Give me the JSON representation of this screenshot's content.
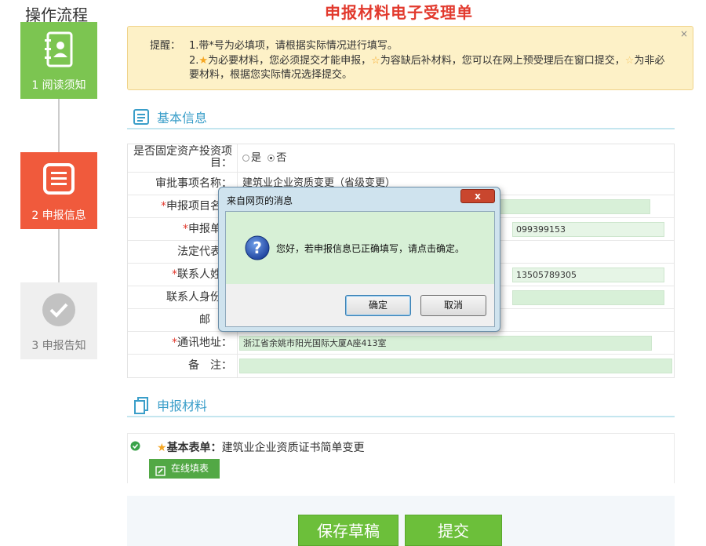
{
  "sidebar": {
    "title": "操作流程",
    "steps": [
      {
        "label": "1 阅读须知"
      },
      {
        "label": "2 申报信息"
      },
      {
        "label": "3 申报告知"
      }
    ]
  },
  "page": {
    "title": "申报材料电子受理单"
  },
  "notice": {
    "label": "提醒：",
    "line1": "1.带*号为必填项，请根据实际情况进行填写。",
    "line2a": "2.",
    "line2b": "为必要材料，您必须提交才能申报，",
    "line2c": "为容缺后补材料，您可以在网上预受理后在窗口提交，",
    "line2d": "为非必要材料，根据您实际情况选择提交。",
    "close": "×"
  },
  "basic": {
    "heading": "基本信息",
    "rows": [
      {
        "label": "是否固定资产投资项目：",
        "yes": "是",
        "no": "否"
      },
      {
        "label": "审批事项名称：",
        "value": "建筑业企业资质变更（省级变更）"
      },
      {
        "label": "申报项目名称",
        "value": ""
      },
      {
        "label": "申报单位",
        "value": "",
        "right_value": "099399153"
      },
      {
        "label": "法定代表人",
        "value": ""
      },
      {
        "label": "联系人姓名",
        "value": "",
        "right_value": "13505789305"
      },
      {
        "label": "联系人身份证",
        "value": ""
      },
      {
        "label": "邮　编",
        "value": ""
      },
      {
        "label": "通讯地址：",
        "value": "浙江省余姚市阳光国际大厦A座413室"
      },
      {
        "label": "备　注：",
        "value": ""
      }
    ],
    "required_mark": "*"
  },
  "materials": {
    "heading": "申报材料",
    "item_label": "基本表单：",
    "item_value": "建筑业企业资质证书简单变更",
    "online_button": "在线填表"
  },
  "actions": {
    "save": "保存草稿",
    "submit": "提交"
  },
  "dialog": {
    "title": "来自网页的消息",
    "close": "x",
    "message": "您好，若申报信息已正确填写，请点击确定。",
    "ok": "确定",
    "cancel": "取消"
  },
  "colors": {
    "accent_green": "#6cbf3a",
    "accent_red": "#f05a3c",
    "title_red": "#e23a2e",
    "heading_blue": "#3a9ec9"
  }
}
